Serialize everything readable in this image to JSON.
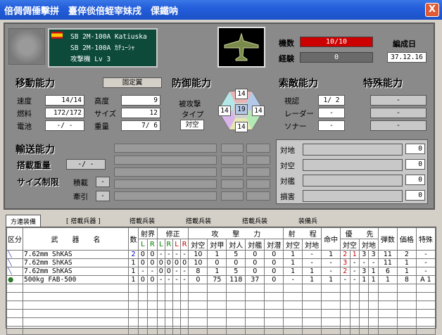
{
  "window": {
    "title": "倍倜倜倕擊拼　臺倅倓倍蛭宰妹戌　倮鐵呐",
    "close": "X"
  },
  "ship": {
    "name1": "SB 2M-100A Katiuska",
    "name2": "SB 2M-100A ｶﾁｭｰｼｬ",
    "type": "攻撃機 Lv 3"
  },
  "status": {
    "count_label": "機数",
    "count": "10/10",
    "exp_label": "経験",
    "exp": "0",
    "date_label": "編成日",
    "date": "37.12.16"
  },
  "move": {
    "header": "移動能力",
    "stance": "固定翼",
    "speed_label": "速度",
    "speed": "14/14",
    "alt_label": "高度",
    "alt": "9",
    "fuel_label": "燃料",
    "fuel": "172/172",
    "size_label": "サイズ",
    "size": "12",
    "battery_label": "電池",
    "battery": "-/ -",
    "weight_label": "重量",
    "weight": "7/ 6"
  },
  "defense": {
    "header": "防御能力",
    "attack_label": "被攻撃",
    "type_label": "タイプ",
    "type": "対空",
    "hex": {
      "top": "14",
      "left": "14",
      "center": "19",
      "right": "14",
      "bottom": "14"
    }
  },
  "detect": {
    "header": "索敵能力",
    "visual_label": "視認",
    "visual": "1/ 2",
    "radar_label": "レーダー",
    "radar": "-",
    "sonar_label": "ソナー",
    "sonar": "-"
  },
  "special": {
    "header": "特殊能力",
    "v1": "-",
    "v2": "-",
    "v3": "-"
  },
  "transport": {
    "header": "輸送能力",
    "load_label": "搭載重量",
    "load": "-/ -",
    "size_label": "サイズ制限",
    "stack_label": "積載",
    "stack": "-",
    "tow_label": "牽引",
    "tow": "-"
  },
  "targets": [
    {
      "label": "対地",
      "value": "0"
    },
    {
      "label": "対空",
      "value": "0"
    },
    {
      "label": "対艦",
      "value": "0"
    },
    {
      "label": "損害",
      "value": "0"
    }
  ],
  "tabs": [
    "方連装備",
    "[ 搭載兵器 ]",
    "搭載兵装",
    "搭載兵装",
    "搭載兵装",
    "装備兵"
  ],
  "table": {
    "headers": {
      "cat": "区分",
      "weapon": "武　　器　　名",
      "count": "数",
      "range": "射界",
      "repair": "修正",
      "attack": "攻　　撃　　力",
      "shoot": "射　　程",
      "hit": "命中",
      "priority": "優　　先",
      "ammo": "弾数",
      "price": "価格",
      "special": "特殊"
    },
    "subheaders": [
      "対空",
      "対甲",
      "対人",
      "対艦",
      "対潜",
      "対空",
      "対地",
      "対空",
      "対地"
    ],
    "rows": [
      {
        "name": "7.62mm ShKAS",
        "n": "2",
        "a": "0",
        "b": "0",
        "c": "-",
        "d": "-",
        "e": "-",
        "f": "-",
        "g": "10",
        "h": "1",
        "i": "5",
        "j": "0",
        "k": "0",
        "l": "1",
        "m": "-",
        "hit": "1",
        "p1": "2",
        "p2": "1",
        "p3": "3",
        "p4": "3",
        "ammo": "11",
        "price": "2",
        "sp": "-"
      },
      {
        "name": "7.62mm ShKAS",
        "n": "1",
        "a": "0",
        "b": "0",
        "c": "0",
        "d": "0",
        "e": "0",
        "f": "0",
        "g": "10",
        "h": "0",
        "i": "0",
        "j": "0",
        "k": "0",
        "l": "1",
        "m": "-",
        "hit": "-",
        "p1": "3",
        "p2": "-",
        "p3": "-",
        "p4": "-",
        "ammo": "11",
        "price": "1",
        "sp": "-"
      },
      {
        "name": "7.62mm ShKAS",
        "n": "1",
        "a": "-",
        "b": "-",
        "c": "0",
        "d": "0",
        "e": "-",
        "f": "-",
        "g": "8",
        "h": "1",
        "i": "5",
        "j": "0",
        "k": "0",
        "l": "1",
        "m": "1",
        "hit": "-",
        "p1": "2",
        "p2": "-",
        "p3": "3",
        "p4": "1",
        "ammo": "6",
        "price": "1",
        "sp": "-"
      },
      {
        "name": "500kg FAB-500",
        "n": "1",
        "a": "0",
        "b": "0",
        "c": "-",
        "d": "-",
        "e": "-",
        "f": "-",
        "g": "0",
        "h": "75",
        "i": "118",
        "j": "37",
        "k": "0",
        "l": "-",
        "m": "1",
        "hit": "1",
        "p1": "-",
        "p2": "-",
        "p3": "1",
        "p4": "1",
        "ammo": "1",
        "price": "8",
        "sp": "A 1"
      }
    ]
  }
}
